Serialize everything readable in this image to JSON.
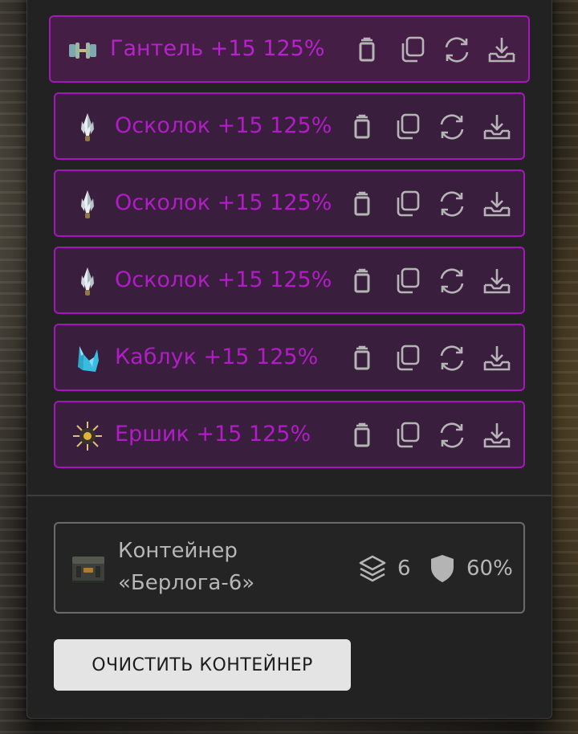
{
  "items": [
    {
      "label": "Гантель +15 125%",
      "icon": "dumbbell-icon"
    },
    {
      "label": "Осколок +15 125%",
      "icon": "shard-icon"
    },
    {
      "label": "Осколок +15 125%",
      "icon": "shard-icon"
    },
    {
      "label": "Осколок +15 125%",
      "icon": "shard-icon"
    },
    {
      "label": "Каблук +15 125%",
      "icon": "heel-crystal-icon"
    },
    {
      "label": "Ершик +15 125%",
      "icon": "spiky-ball-icon"
    }
  ],
  "item_actions": [
    "trash-icon",
    "copy-icon",
    "refresh-icon",
    "download-icon"
  ],
  "container": {
    "name_line1": "Контейнер",
    "name_line2": "«Берлога-6»",
    "slots": "6",
    "protection": "60%"
  },
  "clear_button": "ОЧИСТИТЬ КОНТЕЙНЕР",
  "colors": {
    "accent": "#a417b8",
    "item_text": "#b21cc7",
    "icon_gray": "#b4b4b4",
    "panel_bg": "#222222"
  }
}
